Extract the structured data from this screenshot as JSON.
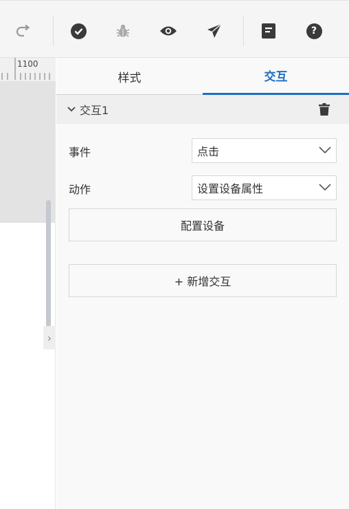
{
  "toolbar": {
    "icons": [
      "redo-icon",
      "check-icon",
      "debug-icon",
      "preview-icon",
      "publish-icon",
      "document-icon",
      "help-icon"
    ],
    "help_glyph": "?"
  },
  "canvas": {
    "ruler_label": "1100",
    "collapse_glyph": "›"
  },
  "panel": {
    "tabs": [
      {
        "label": "样式"
      },
      {
        "label": "交互"
      }
    ],
    "active_tab": 1,
    "section": {
      "title": "交互1"
    },
    "fields": [
      {
        "label": "事件",
        "value": "点击"
      },
      {
        "label": "动作",
        "value": "设置设备属性"
      }
    ],
    "configure_button": "配置设备",
    "add_interaction_button": "+ 新增交互"
  },
  "colors": {
    "accent": "#1c6fc4",
    "icon_dark": "#3a3a3a",
    "icon_disabled": "#a8a8a8"
  }
}
